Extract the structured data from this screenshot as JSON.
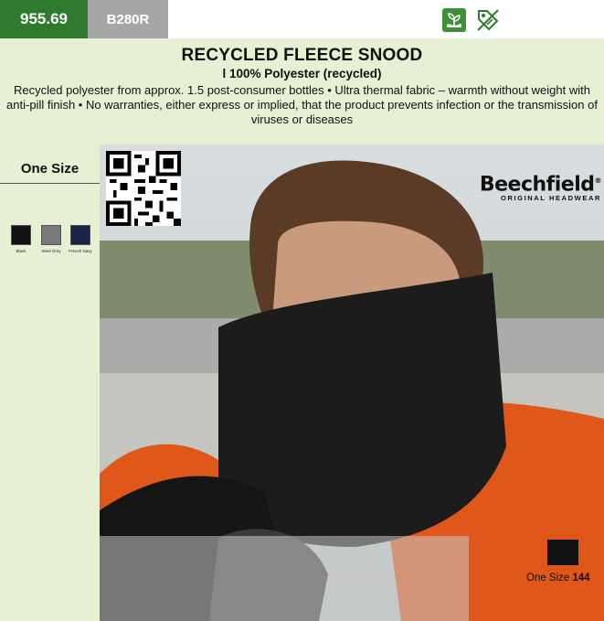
{
  "product": {
    "code": "955.69",
    "reference": "B280R",
    "title": "RECYCLED FLEECE SNOOD",
    "subtitle": "l 100% Polyester (recycled)",
    "description": "Recycled polyester from approx. 1.5 post-consumer bottles • Ultra thermal fabric – warmth without weight with anti-pill finish • No warranties, either express or implied, that the product prevents infection or the transmission of viruses or diseases"
  },
  "icons": [
    "eco-plant-icon",
    "tag-icon"
  ],
  "sizes": {
    "label": "One Size"
  },
  "colors": [
    {
      "name": "Black",
      "hex": "#111111"
    },
    {
      "name": "Steel Grey",
      "hex": "#7a7a7a"
    },
    {
      "name": "French Navy",
      "hex": "#1c2147"
    }
  ],
  "brand": {
    "name": "Beechfield",
    "mark": "®",
    "sub": "ORIGINAL HEADWEAR"
  },
  "packaging": {
    "label": "One Size",
    "quantity": "144"
  },
  "theme": {
    "accent": "#2e7a2f",
    "panel": "#e8f0d3",
    "ref_bg": "#a6a6a6"
  }
}
